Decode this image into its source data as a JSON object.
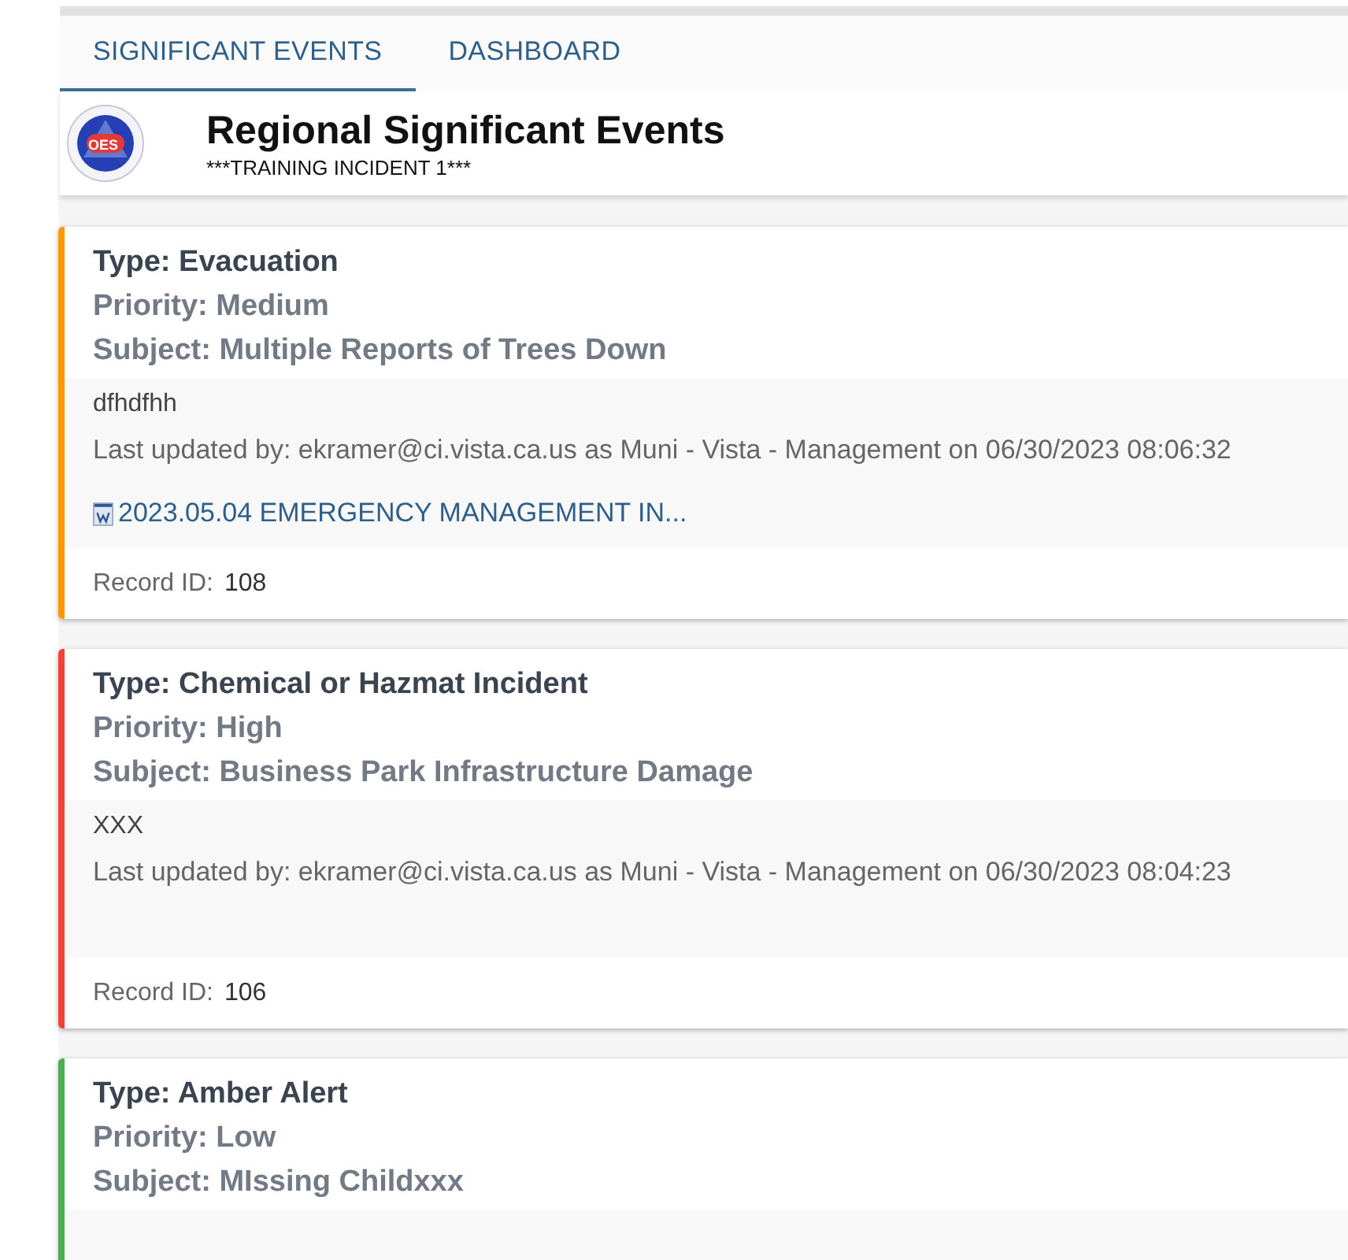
{
  "tabs": [
    {
      "label": "SIGNIFICANT EVENTS",
      "selected": true
    },
    {
      "label": "DASHBOARD",
      "selected": false
    }
  ],
  "header": {
    "logo_text": "OES",
    "title": "Regional Significant Events",
    "subtitle": "***TRAINING INCIDENT 1***"
  },
  "events": [
    {
      "color": "#ff9800",
      "type": "Type: Evacuation",
      "priority": "Priority: Medium",
      "subject": "Subject: Multiple Reports of Trees Down",
      "description": "dfhdfhh",
      "last_updated": "Last updated by: ekramer@ci.vista.ca.us as Muni - Vista - Management on 06/30/2023 08:06:32",
      "attachment": "2023.05.04 EMERGENCY MANAGEMENT IN...",
      "record_label": "Record ID:",
      "record_id": "108"
    },
    {
      "color": "#f44336",
      "type": "Type: Chemical or Hazmat Incident",
      "priority": "Priority: High",
      "subject": "Subject: Business Park Infrastructure Damage",
      "description": "XXX",
      "last_updated": "Last updated by: ekramer@ci.vista.ca.us as Muni - Vista - Management on 06/30/2023 08:04:23",
      "record_label": "Record ID:",
      "record_id": "106"
    },
    {
      "color": "#4caf50",
      "type": "Type: Amber Alert",
      "priority": "Priority: Low",
      "subject": "Subject: MIssing Childxxx"
    }
  ]
}
